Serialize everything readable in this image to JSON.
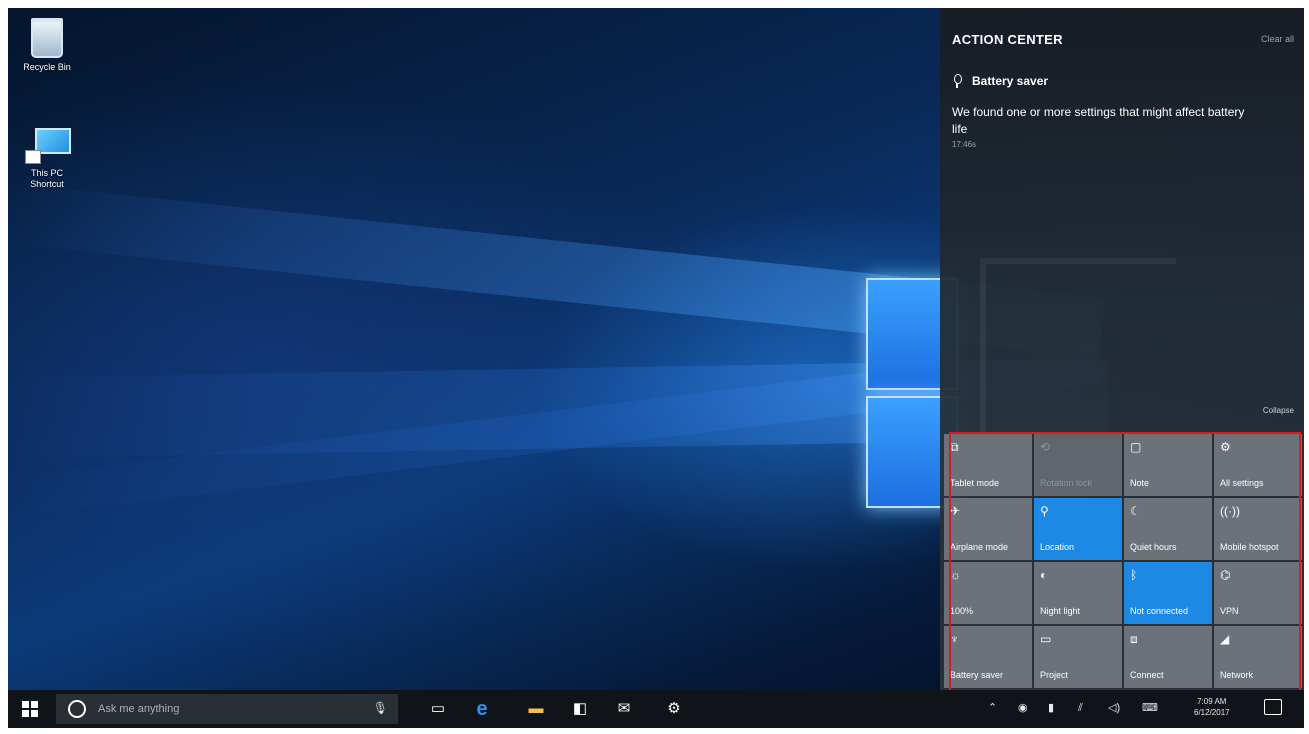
{
  "desktop": {
    "icons": [
      {
        "label": "Recycle Bin"
      },
      {
        "label": "This PC\nShortcut"
      }
    ]
  },
  "action_center": {
    "title": "ACTION CENTER",
    "clear_all": "Clear all",
    "notification": {
      "title": "Battery saver",
      "body": "We found one or more settings that might affect battery life",
      "time": "17:46s"
    },
    "collapse": "Collapse",
    "quick_actions": [
      {
        "label": "Tablet mode",
        "icon": "tablet-icon",
        "glyph": "⧉",
        "state": "off"
      },
      {
        "label": "Rotation lock",
        "icon": "rotation-lock-icon",
        "glyph": "⟲",
        "state": "disabled"
      },
      {
        "label": "Note",
        "icon": "note-icon",
        "glyph": "▢",
        "state": "off"
      },
      {
        "label": "All settings",
        "icon": "gear-icon",
        "glyph": "⚙",
        "state": "off"
      },
      {
        "label": "Airplane mode",
        "icon": "airplane-icon",
        "glyph": "✈",
        "state": "off"
      },
      {
        "label": "Location",
        "icon": "location-icon",
        "glyph": "⚲",
        "state": "on"
      },
      {
        "label": "Quiet hours",
        "icon": "moon-icon",
        "glyph": "☾",
        "state": "off"
      },
      {
        "label": "Mobile hotspot",
        "icon": "hotspot-icon",
        "glyph": "((·))",
        "state": "off"
      },
      {
        "label": "100%",
        "icon": "brightness-icon",
        "glyph": "☼",
        "state": "off"
      },
      {
        "label": "Night light",
        "icon": "night-light-icon",
        "glyph": "◐",
        "state": "off"
      },
      {
        "label": "Not connected",
        "icon": "bluetooth-icon",
        "glyph": "ᛒ",
        "state": "on"
      },
      {
        "label": "VPN",
        "icon": "vpn-icon",
        "glyph": "⌬",
        "state": "off"
      },
      {
        "label": "Battery saver",
        "icon": "battery-saver-icon",
        "glyph": "♆",
        "state": "off"
      },
      {
        "label": "Project",
        "icon": "project-icon",
        "glyph": "▭",
        "state": "off"
      },
      {
        "label": "Connect",
        "icon": "connect-icon",
        "glyph": "⧈",
        "state": "off"
      },
      {
        "label": "Network",
        "icon": "network-icon",
        "glyph": "◢",
        "state": "off"
      }
    ]
  },
  "taskbar": {
    "search_placeholder": "Ask me anything",
    "pinned": [
      {
        "icon": "task-view-icon",
        "glyph": "▭"
      },
      {
        "icon": "edge-icon",
        "glyph": "e"
      },
      {
        "icon": "file-explorer-icon",
        "glyph": "▬"
      },
      {
        "icon": "store-icon",
        "glyph": "◧"
      },
      {
        "icon": "mail-icon",
        "glyph": "✉"
      },
      {
        "icon": "settings-icon",
        "glyph": "⚙"
      }
    ],
    "tray": [
      {
        "icon": "chevron-up-icon",
        "glyph": "⌃"
      },
      {
        "icon": "location-icon",
        "glyph": "◉"
      },
      {
        "icon": "battery-icon",
        "glyph": "▮"
      },
      {
        "icon": "network-icon",
        "glyph": "⫽"
      },
      {
        "icon": "volume-icon",
        "glyph": "◁)"
      },
      {
        "icon": "keyboard-icon",
        "glyph": "⌨"
      }
    ],
    "clock_time": "7:09 AM",
    "clock_date": "6/12/2017"
  },
  "colors": {
    "tile_on": "#1e88e5",
    "tile_off": "#6b7279",
    "highlight": "#e01919"
  }
}
